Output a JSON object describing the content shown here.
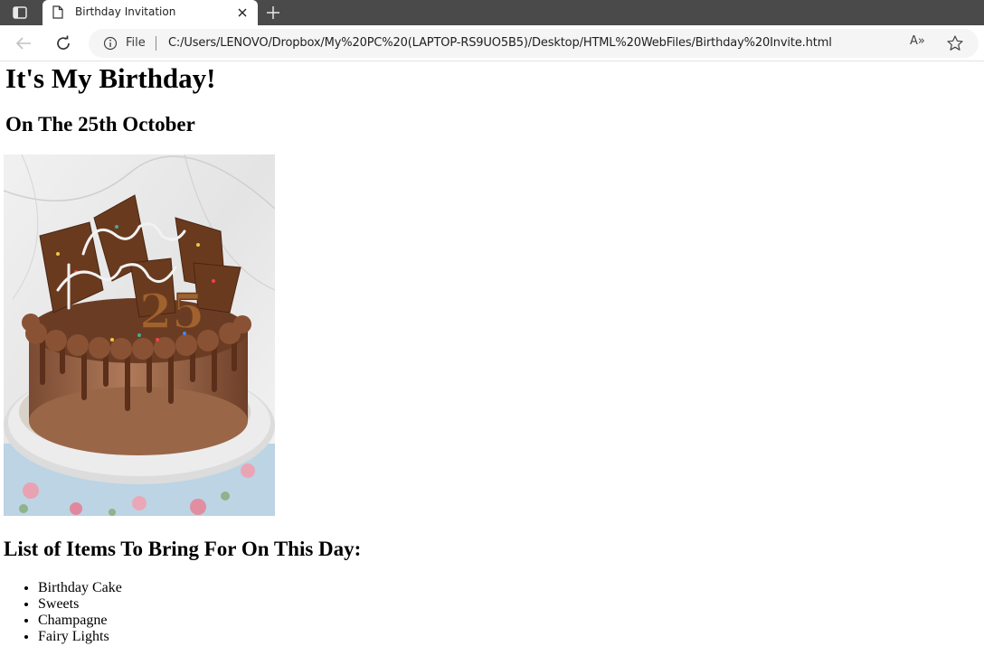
{
  "browser": {
    "tab": {
      "title": "Birthday Invitation"
    },
    "address_bar": {
      "scheme_label": "File",
      "url": "C:/Users/LENOVO/Dropbox/My%20PC%20(LAPTOP-RS9UO5B5)/Desktop/HTML%20WebFiles/Birthday%20Invite.html",
      "read_aloud_label": "A»"
    },
    "icons": {
      "tab_actions": "tab-actions-icon",
      "page": "document-icon",
      "close": "close-icon",
      "new_tab": "plus-icon",
      "back": "back-arrow-icon",
      "reload": "reload-icon",
      "info": "info-icon",
      "favorite": "star-icon"
    }
  },
  "page": {
    "heading": "It's My Birthday!",
    "subheading": "On The 25th October",
    "cake_image": {
      "description_icon": "birthday-cake-image"
    },
    "list_heading": "List of Items To Bring For On This Day:",
    "items": [
      "Birthday Cake",
      "Sweets",
      "Champagne",
      "Fairy Lights"
    ]
  }
}
